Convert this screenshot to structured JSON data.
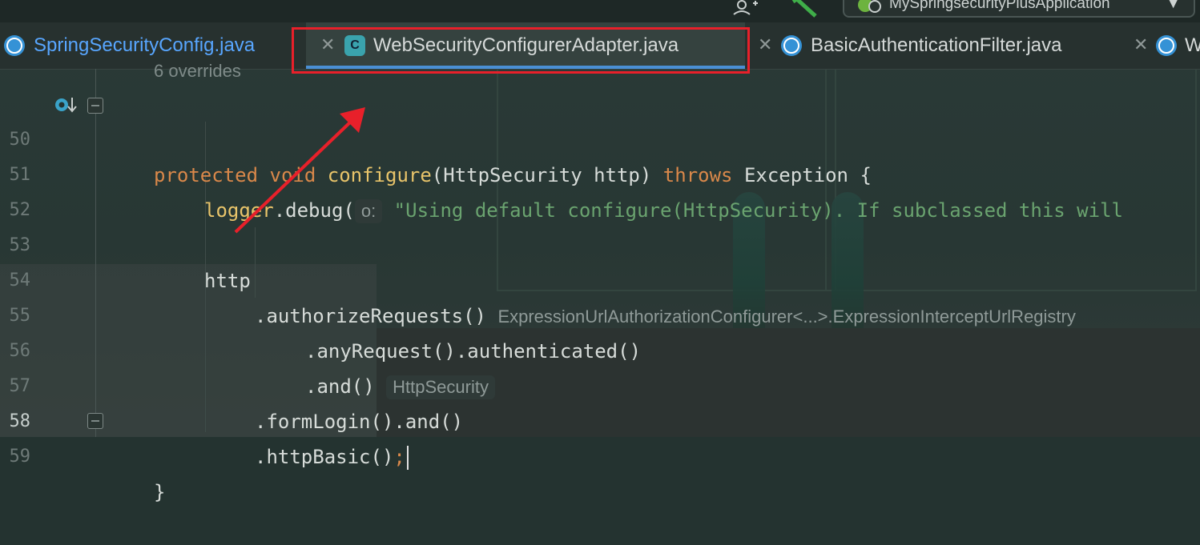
{
  "toolbar": {
    "run_config": "MySpringsecurityPlusApplication"
  },
  "tabs": [
    {
      "label": "SpringSecurityConfig.java",
      "icon": "C"
    },
    {
      "label": "WebSecurityConfigurerAdapter.java",
      "icon": "C",
      "active": true
    },
    {
      "label": "BasicAuthenticationFilter.java",
      "icon": "C"
    },
    {
      "label": "W",
      "icon": "C"
    }
  ],
  "editor": {
    "overrides_hint": "6 overrides",
    "lines": [
      {
        "num": "50",
        "parts": [
          "protected",
          "void",
          "configure",
          "(HttpSecurity http)",
          "throws",
          "Exception {"
        ]
      },
      {
        "num": "51",
        "parts": [
          "logger",
          ".debug(",
          "o:",
          "\"Using default configure(HttpSecurity). If subclassed this will"
        ]
      },
      {
        "num": "52"
      },
      {
        "num": "53",
        "parts": [
          "http"
        ]
      },
      {
        "num": "54",
        "parts": [
          ".authorizeRequests()",
          "ExpressionUrlAuthorizationConfigurer<...>.ExpressionInterceptUrlRegistry"
        ]
      },
      {
        "num": "55",
        "parts": [
          ".anyRequest().authenticated()"
        ]
      },
      {
        "num": "56",
        "parts": [
          ".and()",
          "HttpSecurity"
        ]
      },
      {
        "num": "57",
        "parts": [
          ".formLogin().and()"
        ]
      },
      {
        "num": "58",
        "parts": [
          ".httpBasic()",
          ";"
        ]
      },
      {
        "num": "59",
        "parts": [
          "}"
        ]
      }
    ]
  },
  "colors": {
    "keyword": "#d9884a",
    "string": "#6aa36f",
    "annotation_red": "#e8202a",
    "tab_underline": "#4a8fd4"
  }
}
